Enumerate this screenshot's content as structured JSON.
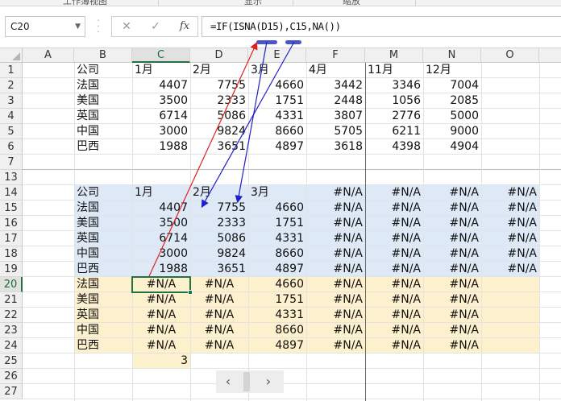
{
  "ribbon": {
    "labels": [
      "工作簿视图",
      "显示",
      "缩放"
    ]
  },
  "formula_bar": {
    "name_box": "C20",
    "cancel_icon": "✕",
    "enter_icon": "✓",
    "fx_label": "fx",
    "formula": "=IF(ISNA(D15),C15,NA())"
  },
  "columns": [
    "A",
    "B",
    "C",
    "D",
    "E",
    "F",
    "M",
    "N",
    "O"
  ],
  "rows": [
    "1",
    "2",
    "3",
    "4",
    "5",
    "6",
    "7",
    "13",
    "14",
    "15",
    "16",
    "17",
    "18",
    "19",
    "20",
    "21",
    "22",
    "23",
    "24",
    "25",
    "26",
    "27"
  ],
  "selected_cell": {
    "column": "C",
    "row": "20"
  },
  "table_top": {
    "header": [
      "公司",
      "1月",
      "2月",
      "3月",
      "4月",
      "11月",
      "12月"
    ],
    "rows": [
      [
        "法国",
        "4407",
        "7755",
        "4660",
        "3442",
        "3346",
        "7004"
      ],
      [
        "美国",
        "3500",
        "2333",
        "1751",
        "2448",
        "1056",
        "2085"
      ],
      [
        "英国",
        "6714",
        "5086",
        "4331",
        "3807",
        "2776",
        "5000"
      ],
      [
        "中国",
        "3000",
        "9824",
        "8660",
        "5705",
        "6211",
        "9000"
      ],
      [
        "巴西",
        "1988",
        "3651",
        "4897",
        "3618",
        "4398",
        "4904"
      ]
    ]
  },
  "table_blue": {
    "header": [
      "公司",
      "1月",
      "2月",
      "3月",
      "#N/A",
      "#N/A",
      "#N/A",
      "#N/A"
    ],
    "rows": [
      [
        "法国",
        "4407",
        "7755",
        "4660",
        "#N/A",
        "#N/A",
        "#N/A",
        "#N/A"
      ],
      [
        "美国",
        "3500",
        "2333",
        "1751",
        "#N/A",
        "#N/A",
        "#N/A",
        "#N/A"
      ],
      [
        "英国",
        "6714",
        "5086",
        "4331",
        "#N/A",
        "#N/A",
        "#N/A",
        "#N/A"
      ],
      [
        "中国",
        "3000",
        "9824",
        "8660",
        "#N/A",
        "#N/A",
        "#N/A",
        "#N/A"
      ],
      [
        "巴西",
        "1988",
        "3651",
        "4897",
        "#N/A",
        "#N/A",
        "#N/A",
        "#N/A"
      ]
    ]
  },
  "table_yellow": {
    "rows": [
      [
        "法国",
        "#N/A",
        "#N/A",
        "4660",
        "#N/A",
        "#N/A",
        "#N/A"
      ],
      [
        "美国",
        "#N/A",
        "#N/A",
        "1751",
        "#N/A",
        "#N/A",
        "#N/A"
      ],
      [
        "英国",
        "#N/A",
        "#N/A",
        "4331",
        "#N/A",
        "#N/A",
        "#N/A"
      ],
      [
        "中国",
        "#N/A",
        "#N/A",
        "8660",
        "#N/A",
        "#N/A",
        "#N/A"
      ],
      [
        "巴西",
        "#N/A",
        "#N/A",
        "4897",
        "#N/A",
        "#N/A",
        "#N/A"
      ]
    ],
    "count": "3"
  },
  "sheet_nav": {
    "prev": "‹",
    "next": "›"
  },
  "colors": {
    "blue_fill": "#dde9f6",
    "yellow_fill": "#fdf0cc",
    "select_green": "#217346",
    "arrow_red": "#e02020",
    "arrow_blue": "#2020c8"
  }
}
